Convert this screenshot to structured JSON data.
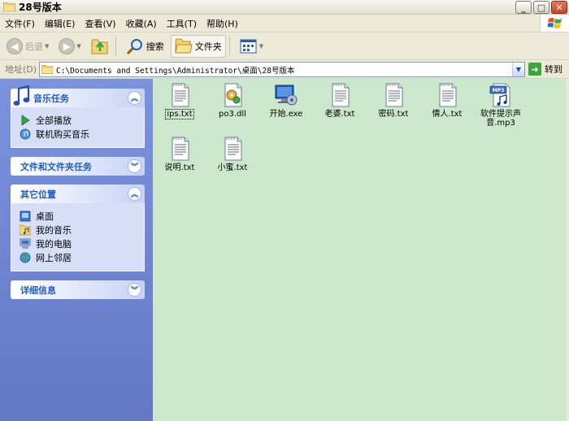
{
  "window": {
    "title": "28号版本",
    "buttons": {
      "minimize": "_",
      "maximize": "□",
      "close": "✕"
    }
  },
  "menu": {
    "items": [
      "文件(F)",
      "编辑(E)",
      "查看(V)",
      "收藏(A)",
      "工具(T)",
      "帮助(H)"
    ]
  },
  "toolbar": {
    "back_label": "后退",
    "search_label": "搜索",
    "folders_label": "文件夹"
  },
  "address": {
    "label": "地址(D)",
    "path": "C:\\Documents and Settings\\Administrator\\桌面\\28号版本",
    "go_label": "转到"
  },
  "left_panel": {
    "music_tasks": {
      "title": "音乐任务",
      "links": [
        "全部播放",
        "联机购买音乐"
      ]
    },
    "file_tasks": {
      "title": "文件和文件夹任务"
    },
    "other_places": {
      "title": "其它位置",
      "links": [
        "桌面",
        "我的音乐",
        "我的电脑",
        "网上邻居"
      ]
    },
    "details": {
      "title": "详细信息"
    }
  },
  "files": [
    {
      "name": "ips.txt",
      "type": "text",
      "icon": "txt-file-icon",
      "selected": true
    },
    {
      "name": "po3.dll",
      "type": "dll",
      "icon": "dll-file-icon",
      "selected": false
    },
    {
      "name": "开始.exe",
      "type": "exe",
      "icon": "exe-file-icon",
      "selected": false
    },
    {
      "name": "老婆.txt",
      "type": "text",
      "icon": "txt-file-icon",
      "selected": false
    },
    {
      "name": "密码.txt",
      "type": "text",
      "icon": "txt-file-icon",
      "selected": false
    },
    {
      "name": "情人.txt",
      "type": "text",
      "icon": "txt-file-icon",
      "selected": false
    },
    {
      "name": "软件提示声音.mp3",
      "type": "mp3",
      "icon": "mp3-file-icon",
      "selected": false
    },
    {
      "name": "说明.txt",
      "type": "text",
      "icon": "txt-file-icon",
      "selected": false
    },
    {
      "name": "小蜜.txt",
      "type": "text",
      "icon": "txt-file-icon",
      "selected": false
    }
  ],
  "colors": {
    "content_bg": "#cbe8cc",
    "panel_bg": "#7b93de",
    "panel_title": "#215dc6",
    "chrome": "#ece9d8"
  }
}
